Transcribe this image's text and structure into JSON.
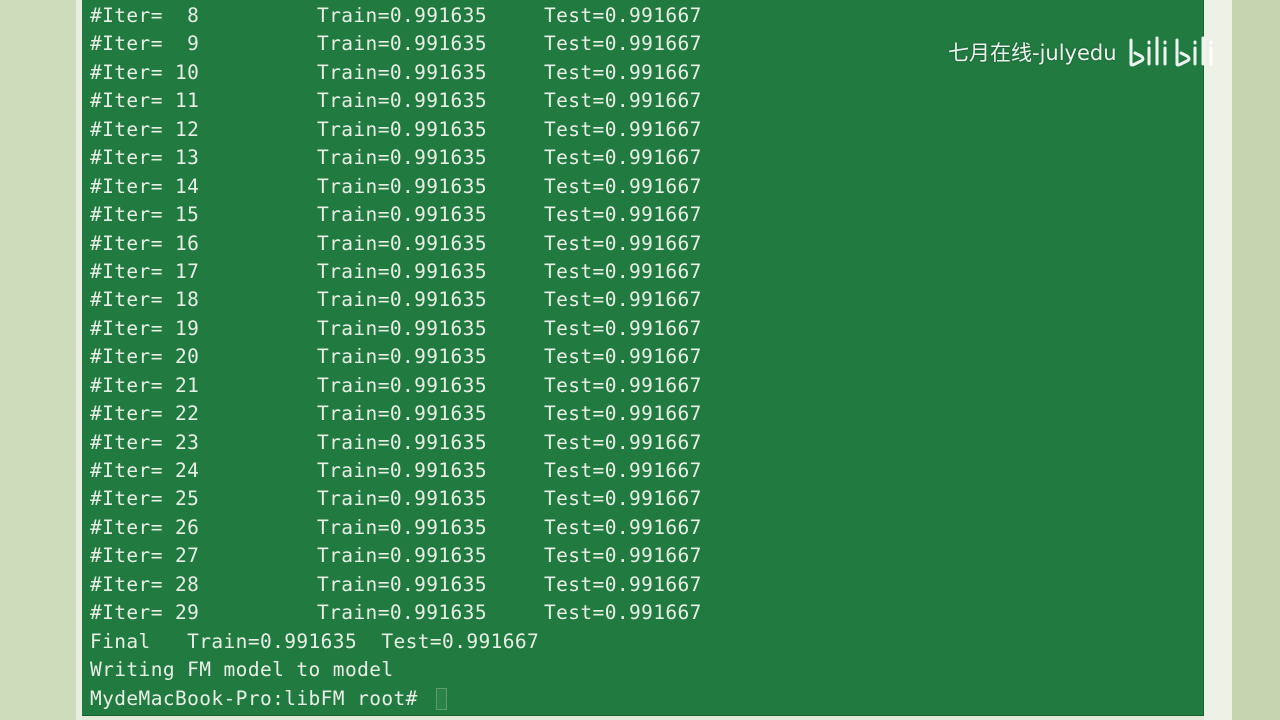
{
  "terminal": {
    "iter_label": "#Iter=",
    "iterations": [
      {
        "iter": " 8",
        "train": "Train=0.991635",
        "test": "Test=0.991667"
      },
      {
        "iter": " 9",
        "train": "Train=0.991635",
        "test": "Test=0.991667"
      },
      {
        "iter": "10",
        "train": "Train=0.991635",
        "test": "Test=0.991667"
      },
      {
        "iter": "11",
        "train": "Train=0.991635",
        "test": "Test=0.991667"
      },
      {
        "iter": "12",
        "train": "Train=0.991635",
        "test": "Test=0.991667"
      },
      {
        "iter": "13",
        "train": "Train=0.991635",
        "test": "Test=0.991667"
      },
      {
        "iter": "14",
        "train": "Train=0.991635",
        "test": "Test=0.991667"
      },
      {
        "iter": "15",
        "train": "Train=0.991635",
        "test": "Test=0.991667"
      },
      {
        "iter": "16",
        "train": "Train=0.991635",
        "test": "Test=0.991667"
      },
      {
        "iter": "17",
        "train": "Train=0.991635",
        "test": "Test=0.991667"
      },
      {
        "iter": "18",
        "train": "Train=0.991635",
        "test": "Test=0.991667"
      },
      {
        "iter": "19",
        "train": "Train=0.991635",
        "test": "Test=0.991667"
      },
      {
        "iter": "20",
        "train": "Train=0.991635",
        "test": "Test=0.991667"
      },
      {
        "iter": "21",
        "train": "Train=0.991635",
        "test": "Test=0.991667"
      },
      {
        "iter": "22",
        "train": "Train=0.991635",
        "test": "Test=0.991667"
      },
      {
        "iter": "23",
        "train": "Train=0.991635",
        "test": "Test=0.991667"
      },
      {
        "iter": "24",
        "train": "Train=0.991635",
        "test": "Test=0.991667"
      },
      {
        "iter": "25",
        "train": "Train=0.991635",
        "test": "Test=0.991667"
      },
      {
        "iter": "26",
        "train": "Train=0.991635",
        "test": "Test=0.991667"
      },
      {
        "iter": "27",
        "train": "Train=0.991635",
        "test": "Test=0.991667"
      },
      {
        "iter": "28",
        "train": "Train=0.991635",
        "test": "Test=0.991667"
      },
      {
        "iter": "29",
        "train": "Train=0.991635",
        "test": "Test=0.991667"
      }
    ],
    "final_line": "Final   Train=0.991635  Test=0.991667",
    "writing_line": "Writing FM model to model",
    "prompt": "MydeMacBook-Pro:libFM root# "
  },
  "watermark": {
    "text": "七月在线-julyedu",
    "logo_text": "bilibili"
  },
  "colors": {
    "terminal_bg": "#217a3f",
    "terminal_fg": "#e8f0e6",
    "frame": "#cbd8b8"
  }
}
